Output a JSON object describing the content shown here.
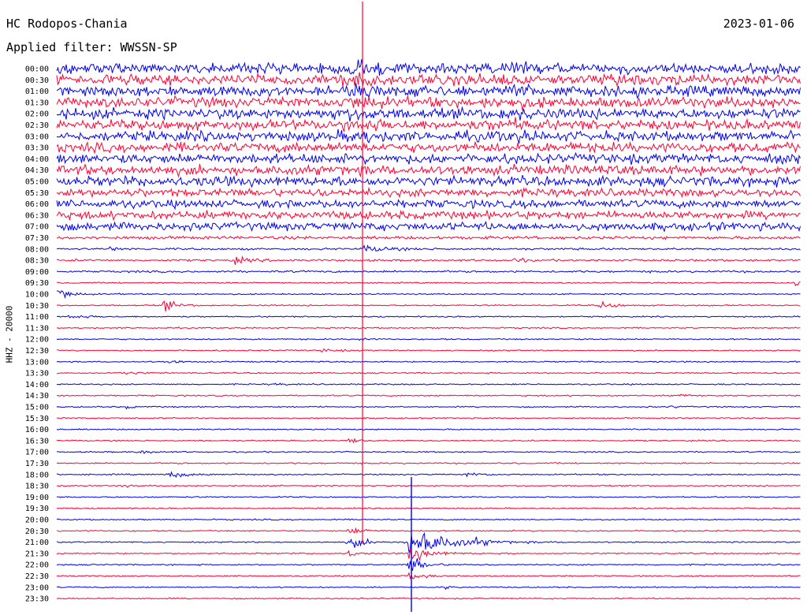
{
  "header": {
    "station": "HC Rodopos-Chania",
    "filter": "Applied filter: WWSSN-SP",
    "date": "2023-01-06"
  },
  "chart_data": {
    "type": "line",
    "ylabel": "HHZ - 20000",
    "time_labels": [
      "00:00",
      "00:30",
      "01:00",
      "01:30",
      "02:00",
      "02:30",
      "03:00",
      "03:30",
      "04:00",
      "04:30",
      "05:00",
      "05:30",
      "06:00",
      "06:30",
      "07:00",
      "07:30",
      "08:00",
      "08:30",
      "09:00",
      "09:30",
      "10:00",
      "10:30",
      "11:00",
      "11:30",
      "12:00",
      "12:30",
      "13:00",
      "13:30",
      "14:00",
      "14:30",
      "15:00",
      "15:30",
      "16:00",
      "16:30",
      "17:00",
      "17:30",
      "18:00",
      "18:30",
      "19:00",
      "19:30",
      "20:00",
      "20:30",
      "21:00",
      "21:30",
      "22:00",
      "22:30",
      "23:00",
      "23:30"
    ],
    "trace_colors": [
      "#0000ee",
      "#ff0033"
    ],
    "grid": false
  }
}
